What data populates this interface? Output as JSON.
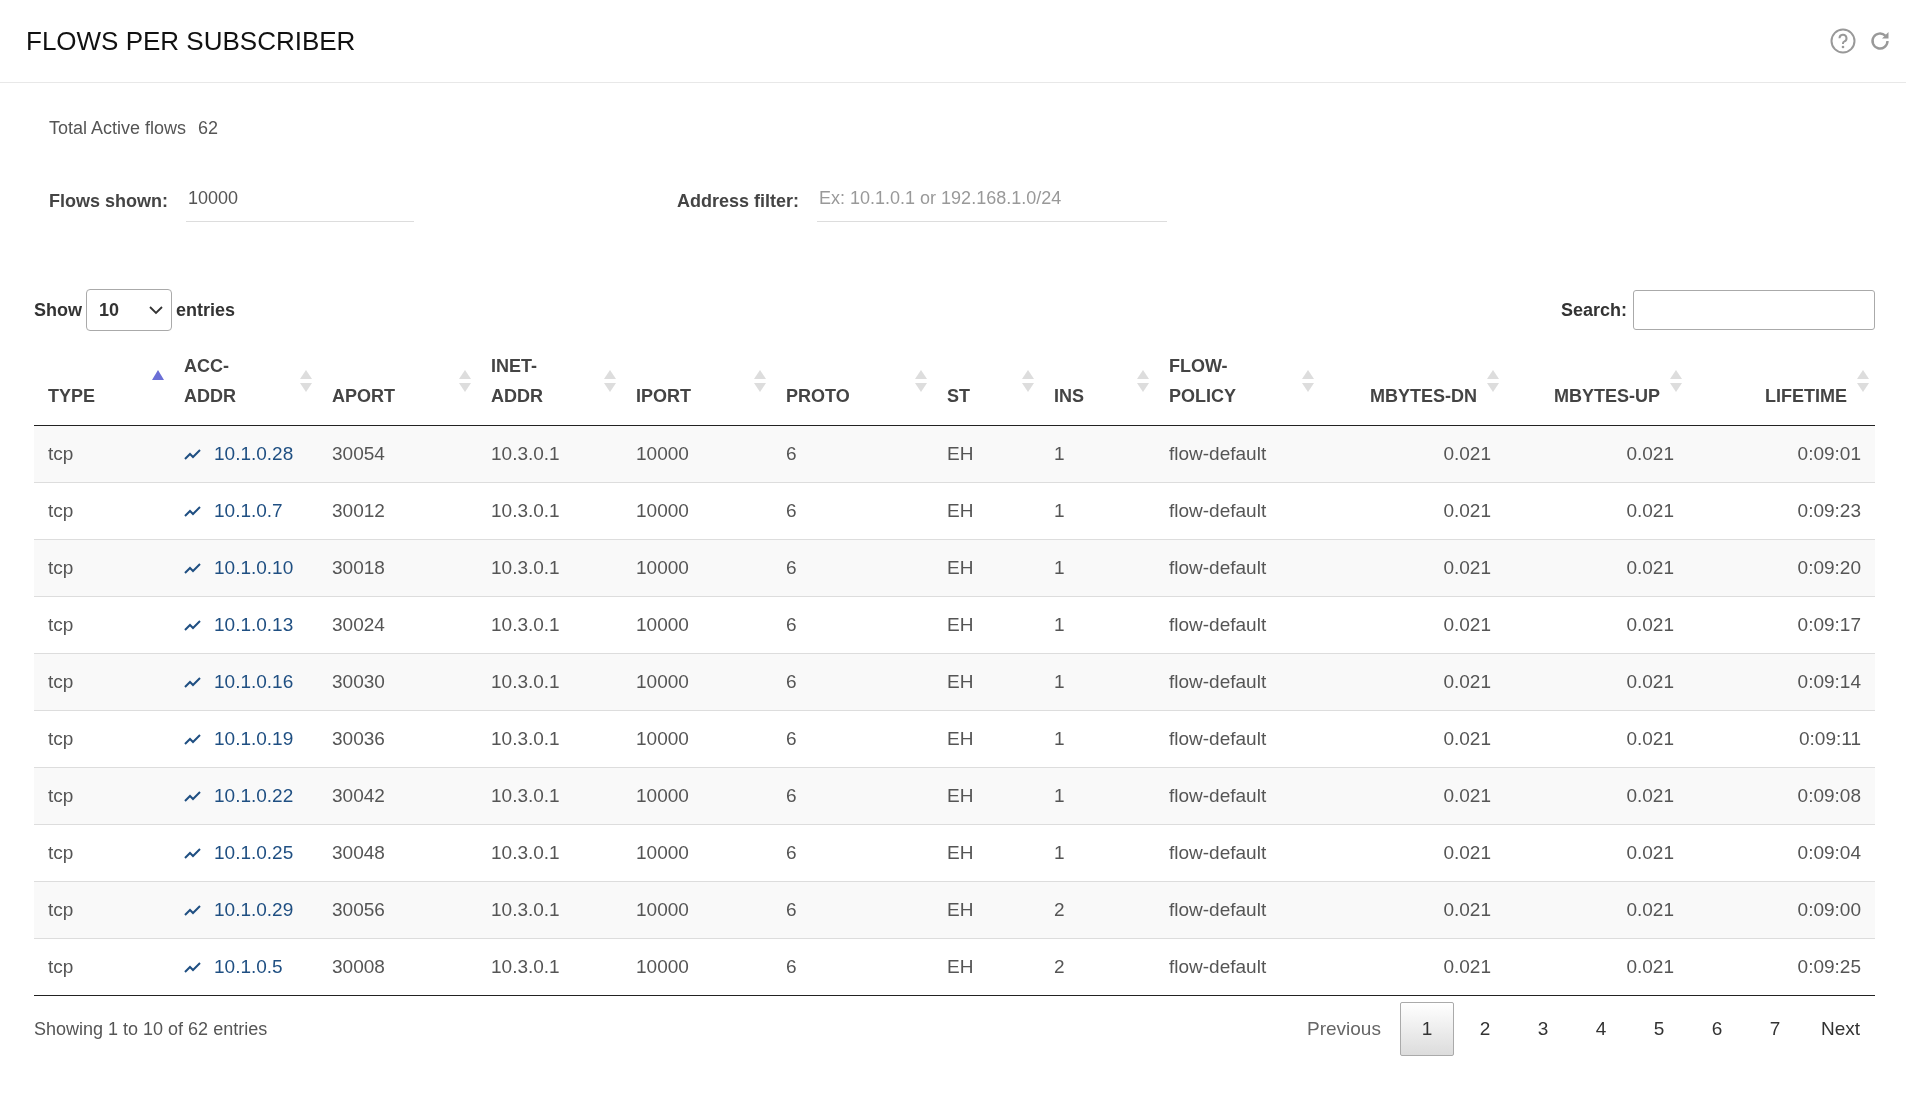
{
  "header": {
    "title": "FLOWS PER SUBSCRIBER"
  },
  "summary": {
    "label": "Total Active flows",
    "value": "62"
  },
  "filters": [
    {
      "label": "Flows shown:",
      "value": "10000"
    },
    {
      "label": "Address filter:",
      "placeholder": "Ex: 10.1.0.1 or 192.168.1.0/24"
    }
  ],
  "length_menu": {
    "before": "Show",
    "value": "10",
    "after": "entries"
  },
  "search": {
    "label": "Search:"
  },
  "table": {
    "columns": [
      {
        "label": "TYPE",
        "sorted_ascending": true,
        "numeric": false
      },
      {
        "label": "ACC-ADDR",
        "sorted_ascending": false,
        "numeric": false
      },
      {
        "label": "APORT",
        "sorted_ascending": false,
        "numeric": false
      },
      {
        "label": "INET-ADDR",
        "sorted_ascending": false,
        "numeric": false
      },
      {
        "label": "IPORT",
        "sorted_ascending": false,
        "numeric": false
      },
      {
        "label": "PROTO",
        "sorted_ascending": false,
        "numeric": false
      },
      {
        "label": "ST",
        "sorted_ascending": false,
        "numeric": false
      },
      {
        "label": "INS",
        "sorted_ascending": false,
        "numeric": false
      },
      {
        "label": "FLOW-POLICY",
        "sorted_ascending": false,
        "numeric": false
      },
      {
        "label": "MBYTES-DN",
        "sorted_ascending": false,
        "numeric": true
      },
      {
        "label": "MBYTES-UP",
        "sorted_ascending": false,
        "numeric": true
      },
      {
        "label": "LIFETIME",
        "sorted_ascending": false,
        "numeric": true
      }
    ],
    "rows": [
      [
        "tcp",
        "10.1.0.28",
        "30054",
        "10.3.0.1",
        "10000",
        "6",
        "EH",
        "1",
        "flow-default",
        "0.021",
        "0.021",
        "0:09:01"
      ],
      [
        "tcp",
        "10.1.0.7",
        "30012",
        "10.3.0.1",
        "10000",
        "6",
        "EH",
        "1",
        "flow-default",
        "0.021",
        "0.021",
        "0:09:23"
      ],
      [
        "tcp",
        "10.1.0.10",
        "30018",
        "10.3.0.1",
        "10000",
        "6",
        "EH",
        "1",
        "flow-default",
        "0.021",
        "0.021",
        "0:09:20"
      ],
      [
        "tcp",
        "10.1.0.13",
        "30024",
        "10.3.0.1",
        "10000",
        "6",
        "EH",
        "1",
        "flow-default",
        "0.021",
        "0.021",
        "0:09:17"
      ],
      [
        "tcp",
        "10.1.0.16",
        "30030",
        "10.3.0.1",
        "10000",
        "6",
        "EH",
        "1",
        "flow-default",
        "0.021",
        "0.021",
        "0:09:14"
      ],
      [
        "tcp",
        "10.1.0.19",
        "30036",
        "10.3.0.1",
        "10000",
        "6",
        "EH",
        "1",
        "flow-default",
        "0.021",
        "0.021",
        "0:09:11"
      ],
      [
        "tcp",
        "10.1.0.22",
        "30042",
        "10.3.0.1",
        "10000",
        "6",
        "EH",
        "1",
        "flow-default",
        "0.021",
        "0.021",
        "0:09:08"
      ],
      [
        "tcp",
        "10.1.0.25",
        "30048",
        "10.3.0.1",
        "10000",
        "6",
        "EH",
        "1",
        "flow-default",
        "0.021",
        "0.021",
        "0:09:04"
      ],
      [
        "tcp",
        "10.1.0.29",
        "30056",
        "10.3.0.1",
        "10000",
        "6",
        "EH",
        "2",
        "flow-default",
        "0.021",
        "0.021",
        "0:09:00"
      ],
      [
        "tcp",
        "10.1.0.5",
        "30008",
        "10.3.0.1",
        "10000",
        "6",
        "EH",
        "2",
        "flow-default",
        "0.021",
        "0.021",
        "0:09:25"
      ]
    ]
  },
  "info": "Showing 1 to 10 of 62 entries",
  "pagination": {
    "previous": "Previous",
    "pages": [
      {
        "label": "1",
        "selected": true
      },
      {
        "label": "2",
        "selected": false
      },
      {
        "label": "3",
        "selected": false
      },
      {
        "label": "4",
        "selected": false
      },
      {
        "label": "5",
        "selected": false
      },
      {
        "label": "6",
        "selected": false
      },
      {
        "label": "7",
        "selected": false
      }
    ],
    "next": "Next"
  }
}
